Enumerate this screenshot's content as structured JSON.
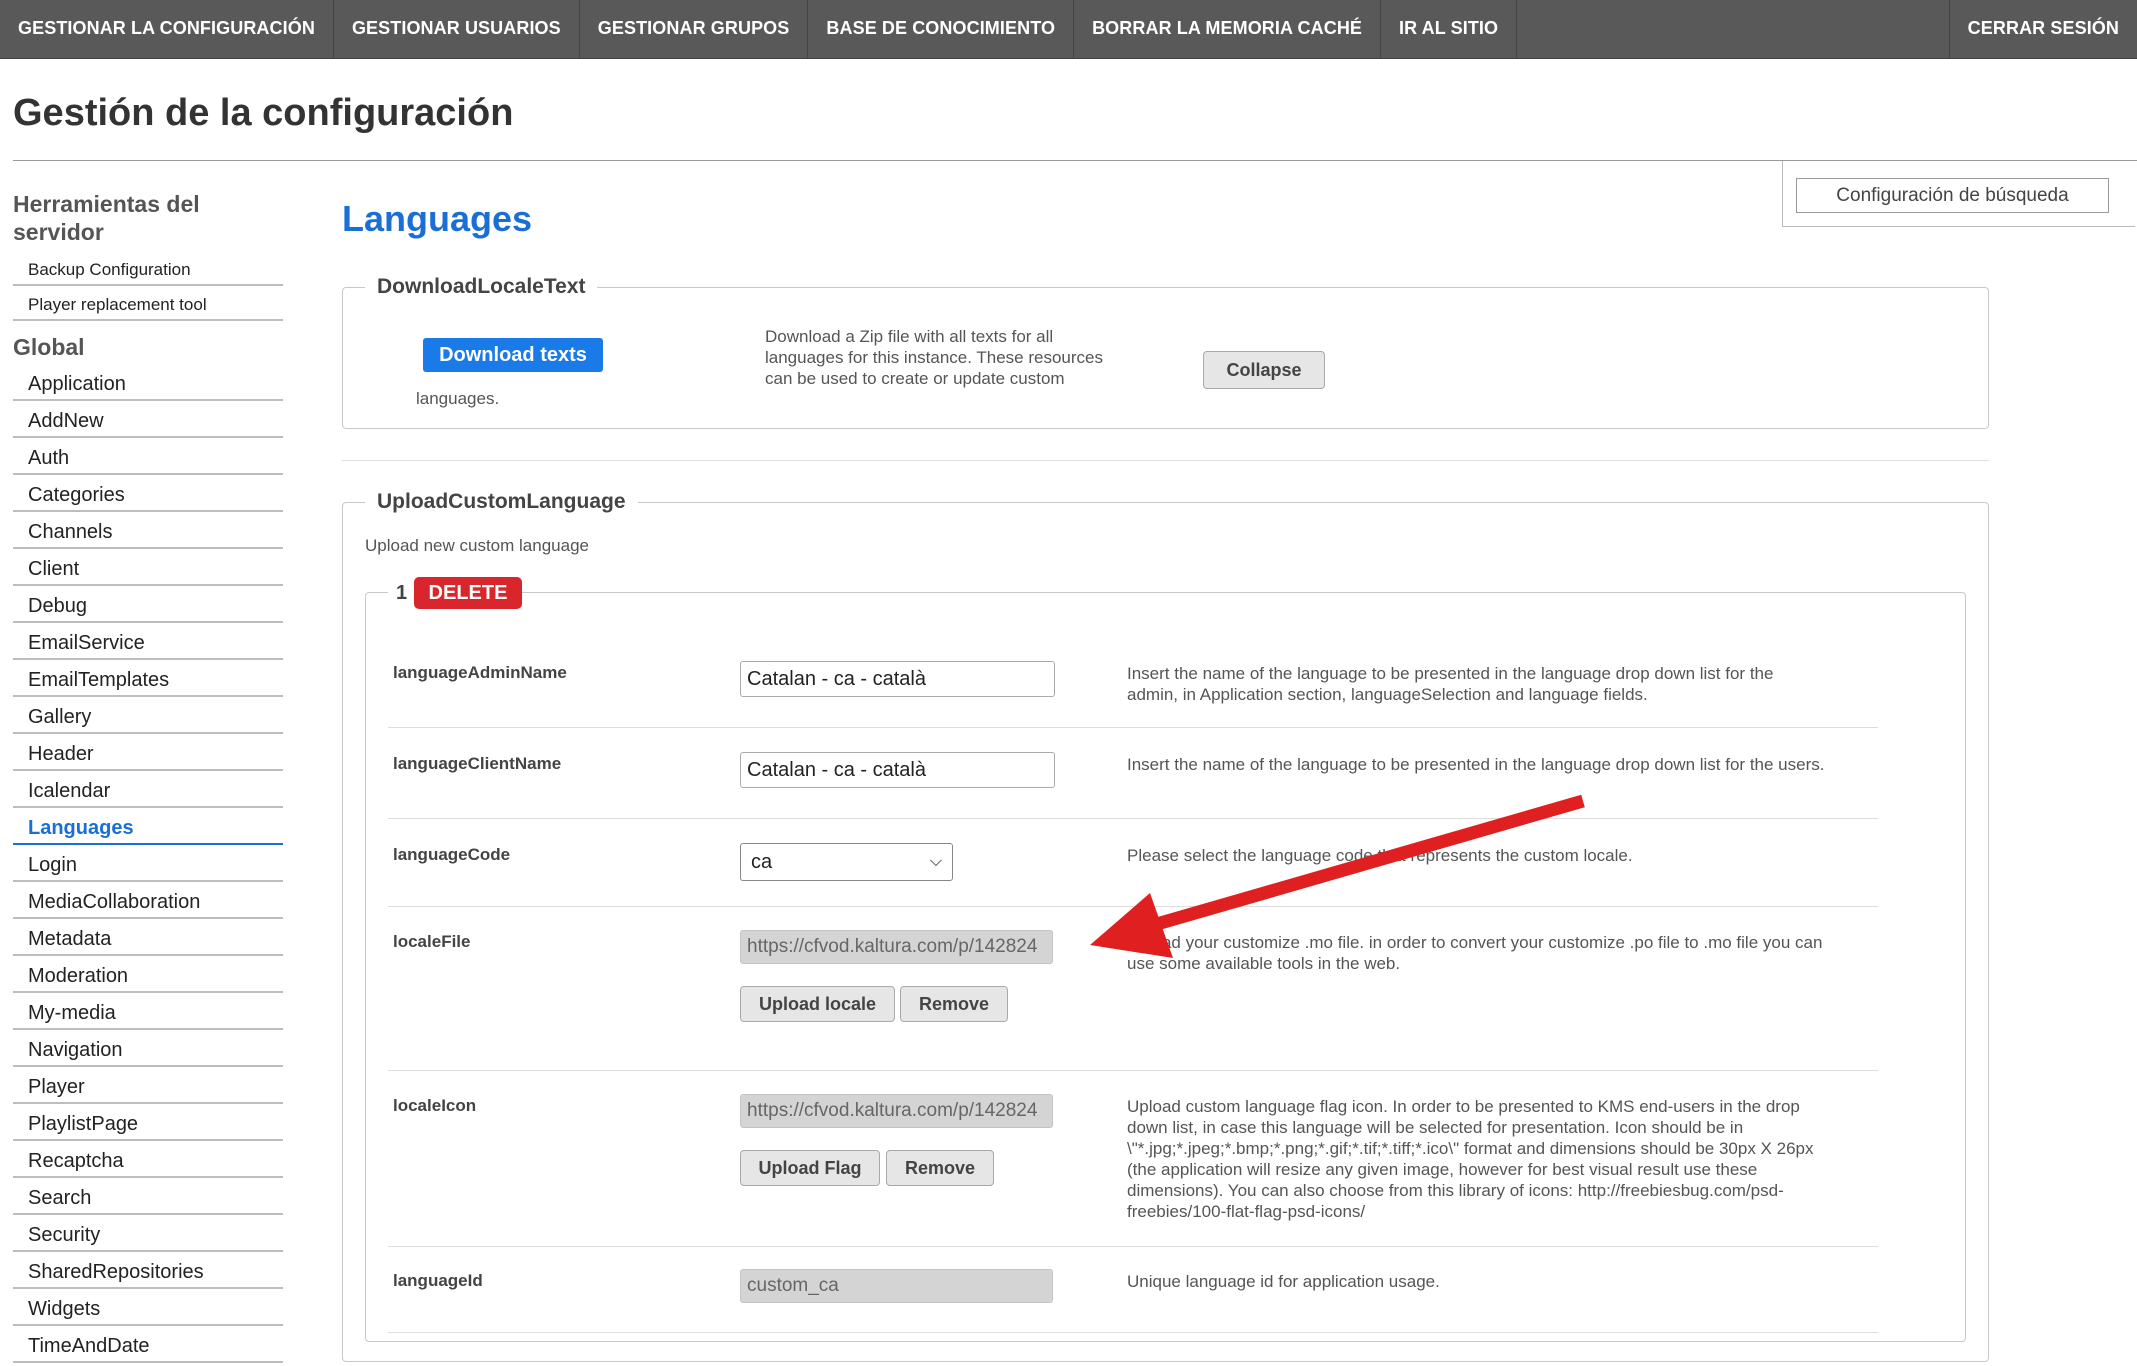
{
  "topnav": {
    "items": [
      "GESTIONAR LA CONFIGURACIÓN",
      "GESTIONAR USUARIOS",
      "GESTIONAR GRUPOS",
      "BASE DE CONOCIMIENTO",
      "BORRAR LA MEMORIA CACHÉ",
      "IR AL SITIO"
    ],
    "logout": "CERRAR SESIÓN"
  },
  "page_title": "Gestión de la configuración",
  "search_config_button": "Configuración de búsqueda",
  "sidebar": {
    "server_tools_heading": "Herramientas del servidor",
    "server_tools": [
      "Backup Configuration",
      "Player replacement tool"
    ],
    "global_heading": "Global",
    "global_items": [
      "Application",
      "AddNew",
      "Auth",
      "Categories",
      "Channels",
      "Client",
      "Debug",
      "EmailService",
      "EmailTemplates",
      "Gallery",
      "Header",
      "Icalendar",
      "Languages",
      "Login",
      "MediaCollaboration",
      "Metadata",
      "Moderation",
      "My-media",
      "Navigation",
      "Player",
      "PlaylistPage",
      "Recaptcha",
      "Search",
      "Security",
      "SharedRepositories",
      "Widgets",
      "TimeAndDate"
    ],
    "active_item": "Languages"
  },
  "main": {
    "title": "Languages",
    "download": {
      "legend": "DownloadLocaleText",
      "button": "Download texts",
      "suffix": "languages.",
      "description": "Download a Zip file with all texts for all languages for this instance. These resources can be used to create or update custom",
      "collapse": "Collapse"
    },
    "upload": {
      "legend": "UploadCustomLanguage",
      "subtitle": "Upload new custom language",
      "item_number": "1",
      "delete_label": "DELETE",
      "fields": {
        "admin_name": {
          "label": "languageAdminName",
          "value": "Catalan - ca - català",
          "help": "Insert the name of the language to be presented in the language drop down list for the admin, in Application section, languageSelection and language fields."
        },
        "client_name": {
          "label": "languageClientName",
          "value": "Catalan - ca - català",
          "help": "Insert the name of the language to be presented in the language drop down list for the users."
        },
        "code": {
          "label": "languageCode",
          "value": "ca",
          "help": "Please select the language code that represents the custom locale."
        },
        "locale_file": {
          "label": "localeFile",
          "value": "https://cfvod.kaltura.com/p/142824",
          "upload": "Upload locale",
          "remove": "Remove",
          "help": "Upload your customize .mo file. in order to convert your customize .po file to .mo file you can use some available tools in the web."
        },
        "locale_icon": {
          "label": "localeIcon",
          "value": "https://cfvod.kaltura.com/p/142824",
          "upload": "Upload Flag",
          "remove": "Remove",
          "help": "Upload custom language flag icon. In order to be presented to KMS end-users in the drop down list, in case this language will be selected for presentation. Icon should be in \\\"*.jpg;*.jpeg;*.bmp;*.png;*.gif;*.tif;*.tiff;*.ico\\\" format and dimensions should be 30px X 26px (the application will resize any given image, however for best visual result use these dimensions). You can also choose from this library of icons: http://freebiesbug.com/psd-freebies/100-flat-flag-psd-icons/"
        },
        "language_id": {
          "label": "languageId",
          "value": "custom_ca",
          "help": "Unique language id for application usage."
        }
      }
    }
  },
  "colors": {
    "nav_bg": "#595959",
    "accent": "#1a6fd6",
    "button_blue": "#1a7ae8",
    "delete_red": "#d9262c",
    "arrow_red": "#e02020"
  },
  "icons": {
    "select_chevron": "chevron-down-icon",
    "annotation": "red-arrow-annotation"
  }
}
